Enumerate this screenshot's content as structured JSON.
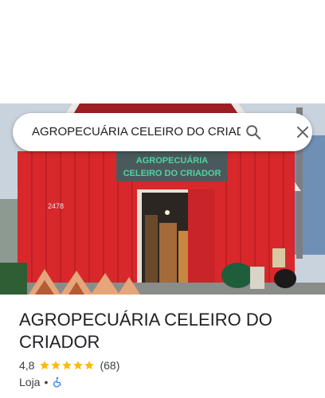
{
  "search": {
    "query": "AGROPECUÁRIA CELEIRO DO CRIADOR"
  },
  "photo": {
    "sign_line_1": "AGROPECUÁRIA",
    "sign_line_2": "CELEIRO DO CRIADOR",
    "door_number": "2478"
  },
  "place": {
    "title": "AGROPECUÁRIA CELEIRO DO CRIADOR",
    "rating": "4,8",
    "stars": 5,
    "review_count": "(68)",
    "category": "Loja",
    "separator": "•"
  },
  "colors": {
    "star": "#fbbc04",
    "accessibility_icon": "#1a73e8",
    "barn_red": "#d8282b"
  },
  "icons": [
    "search-icon",
    "close-icon",
    "star-icon",
    "wheelchair-accessible-icon"
  ]
}
